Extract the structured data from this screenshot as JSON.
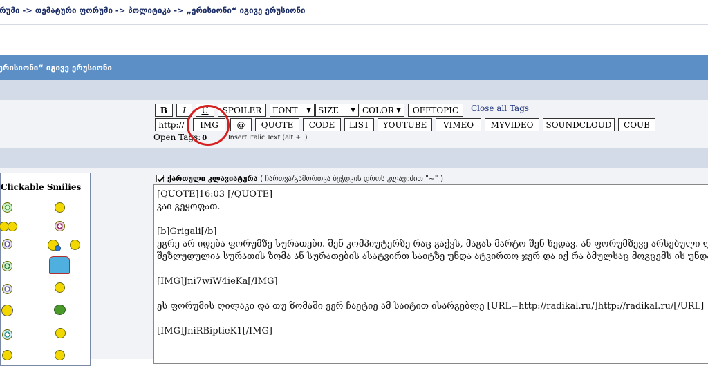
{
  "breadcrumb": "ფორუმი -> თემატური ფორუმი -> პოლიტიკა -> „ერისიონი“ იგივე ერუსიონი",
  "topic_title": "„ერისიონი“ იგივე ერუსიონი",
  "toolbar": {
    "bold": "B",
    "italic": "I",
    "underline": "U",
    "spoiler": "SPOILER",
    "font": "FONT",
    "size": "SIZE",
    "color": "COLOR",
    "offtopic": "OFFTOPIC",
    "close_all_tags": "Close all Tags",
    "http": "http://",
    "img": "IMG",
    "at": "@",
    "quote": "QUOTE",
    "code": "CODE",
    "list": "LIST",
    "youtube": "YOUTUBE",
    "vimeo": "VIMEO",
    "myvideo": "MYVIDEO",
    "soundcloud": "SOUNDCLOUD",
    "coub": "COUB",
    "dropdown_arrow": "▼"
  },
  "open_tags": {
    "label": "Open Tags:",
    "count": "0",
    "hint": "Insert Italic Text (alt + i)"
  },
  "smilies": {
    "header": "Clickable Smilies"
  },
  "keyboard": {
    "title": "ქართული კლავიატურა",
    "note": "( ჩართვა/გამორთვა ბეჭდვის დროს კლავიშით \"~\" )",
    "checked": true
  },
  "post_lines": [
    "[QUOTE]16:03 [/QUOTE]",
    "კაი გეყოფათ.",
    "",
    "[b]Grigali[/b]",
    "ეგრე არ იდება ფორუმზე სურათები. შენ კომპიუტერზე რაც გაქვს, მაგას მარტო შენ ხედავ. ან ფორუმზევე არსებული ღილაკით",
    "შეზღუდულია სურათის ზომა ან სურათების ასატვირთ საიტზე უნდა ატვირთო ჯერ და იქ რა ბმულსაც მოგცემს ის უნდა დასვა",
    "",
    "[IMG]Jni7wiW4ieKa[/IMG]",
    "",
    "ეს ფორუმის ღილაკი და თუ ზომაში ვერ ჩაეტიე ამ საიტით ისარგებლე  [URL=http://radikal.ru/]http://radikal.ru/[/URL]",
    "",
    "[IMG]JniRBiptieK1[/IMG]"
  ],
  "colors": {
    "title_bar": "#5d8fc7",
    "breadcrumb": "#1e2f66",
    "highlight_circle": "#d62020"
  }
}
